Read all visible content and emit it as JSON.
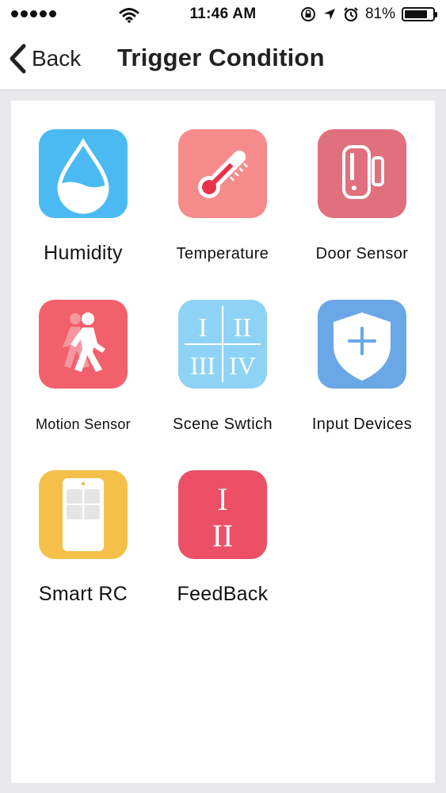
{
  "status_bar": {
    "time": "11:46 AM",
    "battery_percent": "81%",
    "battery_level": 0.81,
    "icons": [
      "signal-dots-icon",
      "wifi-icon",
      "orientation-lock-icon",
      "location-arrow-icon",
      "alarm-icon",
      "battery-icon"
    ]
  },
  "nav": {
    "back_label": "Back",
    "title": "Trigger Condition"
  },
  "triggers": [
    {
      "label": "Humidity",
      "icon": "water-drop-icon",
      "color": "#4bbaf2"
    },
    {
      "label": "Temperature",
      "icon": "thermometer-icon",
      "color": "#f58b8b"
    },
    {
      "label": "Door Sensor",
      "icon": "door-sensor-icon",
      "color": "#e0707e"
    },
    {
      "label": "Motion Sensor",
      "icon": "walking-person-icon",
      "color": "#f2606c"
    },
    {
      "label": "Scene Swtich",
      "icon": "roman-numerals-grid-icon",
      "color": "#8ed3f5"
    },
    {
      "label": "Input Devices",
      "icon": "shield-plus-icon",
      "color": "#6aa7e6"
    },
    {
      "label": "Smart RC",
      "icon": "remote-control-icon",
      "color": "#f5c04a"
    },
    {
      "label": "FeedBack",
      "icon": "roman-one-two-icon",
      "color": "#ec4f66"
    }
  ],
  "icon_text": {
    "scene": [
      "I",
      "II",
      "III",
      "IV"
    ],
    "feedback": [
      "I",
      "II"
    ]
  }
}
